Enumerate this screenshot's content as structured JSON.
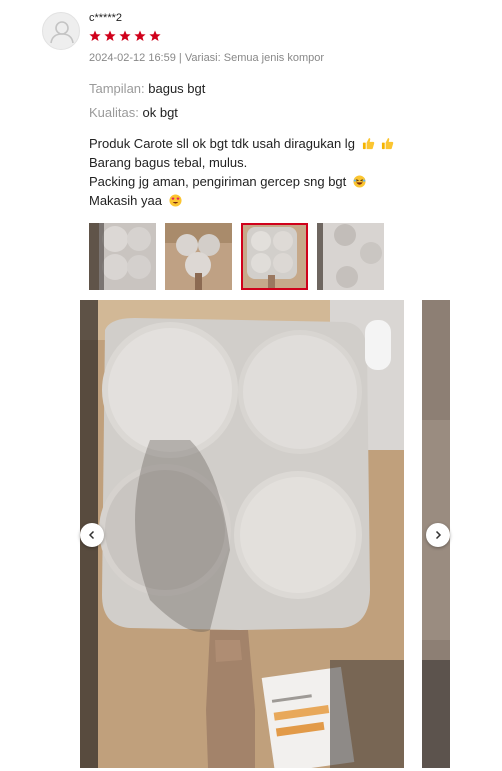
{
  "review": {
    "username": "c*****2",
    "rating": 5,
    "star_color": "#d0011b",
    "date_time": "2024-02-12 16:59",
    "variation": "Variasi: Semua jenis kompor",
    "meta_text": "2024-02-12 16:59 | Variasi: Semua jenis kompor",
    "attributes": [
      {
        "key": "Tampilan:",
        "value": "bagus bgt"
      },
      {
        "key": "Kualitas:",
        "value": "ok bgt"
      }
    ],
    "comment_lines": [
      "Produk Carote sll ok bgt tdk usah diragukan lg",
      "Barang bagus tebal, mulus.",
      "Packing jg aman, pengiriman gercep sng bgt",
      "Makasih yaa"
    ],
    "comment_emojis": [
      "thumbs-up-icon",
      "thumbs-up-icon",
      "laughing-face-icon",
      "heart-eyes-icon"
    ],
    "thumbnails": [
      {
        "name": "thumbnail-1",
        "active": false
      },
      {
        "name": "thumbnail-2",
        "active": false
      },
      {
        "name": "thumbnail-3",
        "active": true
      },
      {
        "name": "thumbnail-4",
        "active": false
      }
    ]
  },
  "viewer": {
    "prev_icon": "chevron-left-icon",
    "next_icon": "chevron-right-icon"
  }
}
